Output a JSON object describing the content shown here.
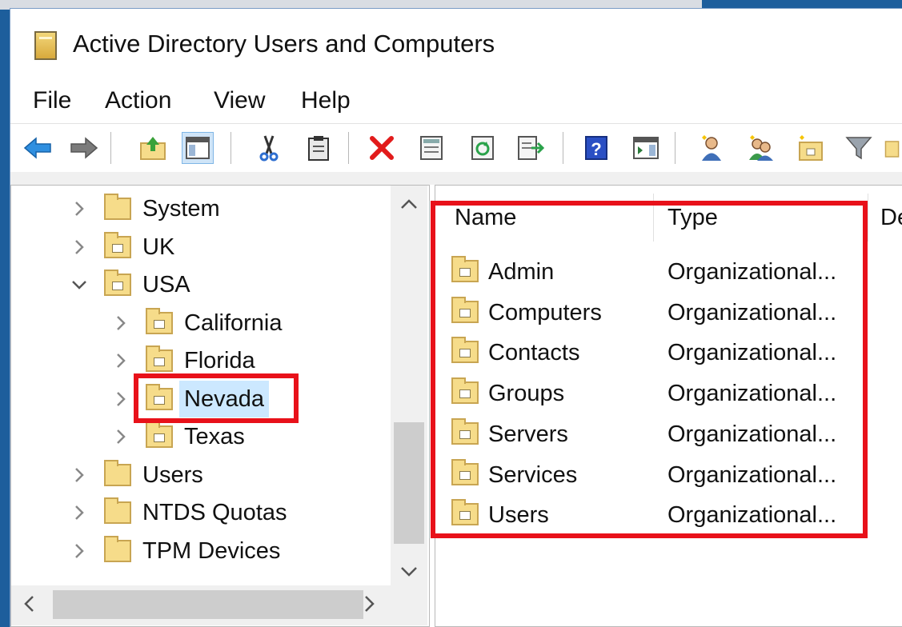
{
  "window": {
    "title": "Active Directory Users and Computers"
  },
  "menu": {
    "items": [
      "File",
      "Action",
      "View",
      "Help"
    ]
  },
  "toolbar": {
    "icons": [
      "back-arrow-icon",
      "forward-arrow-icon",
      "up-folder-icon",
      "show-hide-console-tree-icon",
      "cut-icon",
      "paste-icon",
      "delete-icon",
      "properties-icon",
      "refresh-icon",
      "export-list-icon",
      "help-icon",
      "action-pane-icon",
      "new-user-icon",
      "new-group-icon",
      "new-ou-icon",
      "filter-icon",
      "find-icon"
    ]
  },
  "tree": {
    "items": [
      {
        "label": "System",
        "level": 1,
        "kind": "folder",
        "expanded": false
      },
      {
        "label": "UK",
        "level": 1,
        "kind": "ou",
        "expanded": false
      },
      {
        "label": "USA",
        "level": 1,
        "kind": "ou",
        "expanded": true
      },
      {
        "label": "California",
        "level": 2,
        "kind": "ou",
        "expanded": false
      },
      {
        "label": "Florida",
        "level": 2,
        "kind": "ou",
        "expanded": false
      },
      {
        "label": "Nevada",
        "level": 2,
        "kind": "ou",
        "expanded": false,
        "selected": true
      },
      {
        "label": "Texas",
        "level": 2,
        "kind": "ou",
        "expanded": false
      },
      {
        "label": "Users",
        "level": 1,
        "kind": "folder",
        "expanded": false
      },
      {
        "label": "NTDS Quotas",
        "level": 1,
        "kind": "folder",
        "expanded": false
      },
      {
        "label": "TPM Devices",
        "level": 1,
        "kind": "folder",
        "expanded": false
      }
    ]
  },
  "list": {
    "columns": [
      "Name",
      "Type",
      "De"
    ],
    "rows": [
      {
        "name": "Admin",
        "type": "Organizational..."
      },
      {
        "name": "Computers",
        "type": "Organizational..."
      },
      {
        "name": "Contacts",
        "type": "Organizational..."
      },
      {
        "name": "Groups",
        "type": "Organizational..."
      },
      {
        "name": "Servers",
        "type": "Organizational..."
      },
      {
        "name": "Services",
        "type": "Organizational..."
      },
      {
        "name": "Users",
        "type": "Organizational..."
      }
    ]
  },
  "colors": {
    "highlight": "#e8111a",
    "selection": "#cce8ff",
    "desktop": "#1d5e9c"
  }
}
